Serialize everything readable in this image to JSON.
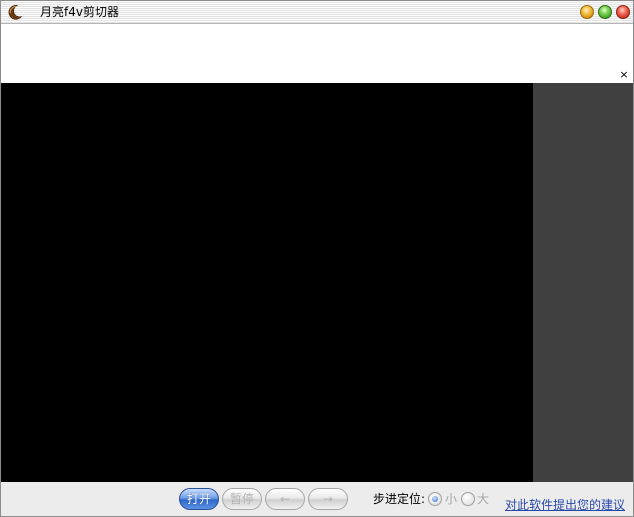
{
  "window": {
    "title": "月亮f4v剪切器",
    "icon": "crescent-moon-icon"
  },
  "banner": {
    "close_label": "×"
  },
  "toolbar": {
    "open_label": "打开",
    "pause_label": "暂停",
    "back_label": "←",
    "forward_label": "→",
    "step_label": "步进定位:",
    "step_options": [
      {
        "label": "小",
        "selected": true
      },
      {
        "label": "大",
        "selected": false
      }
    ],
    "feedback_link": "对此软件提出您的建议"
  },
  "colors": {
    "video_background": "#000000",
    "side_panel": "#404040",
    "toolbar_background": "#ececec",
    "link": "#2848a8"
  }
}
